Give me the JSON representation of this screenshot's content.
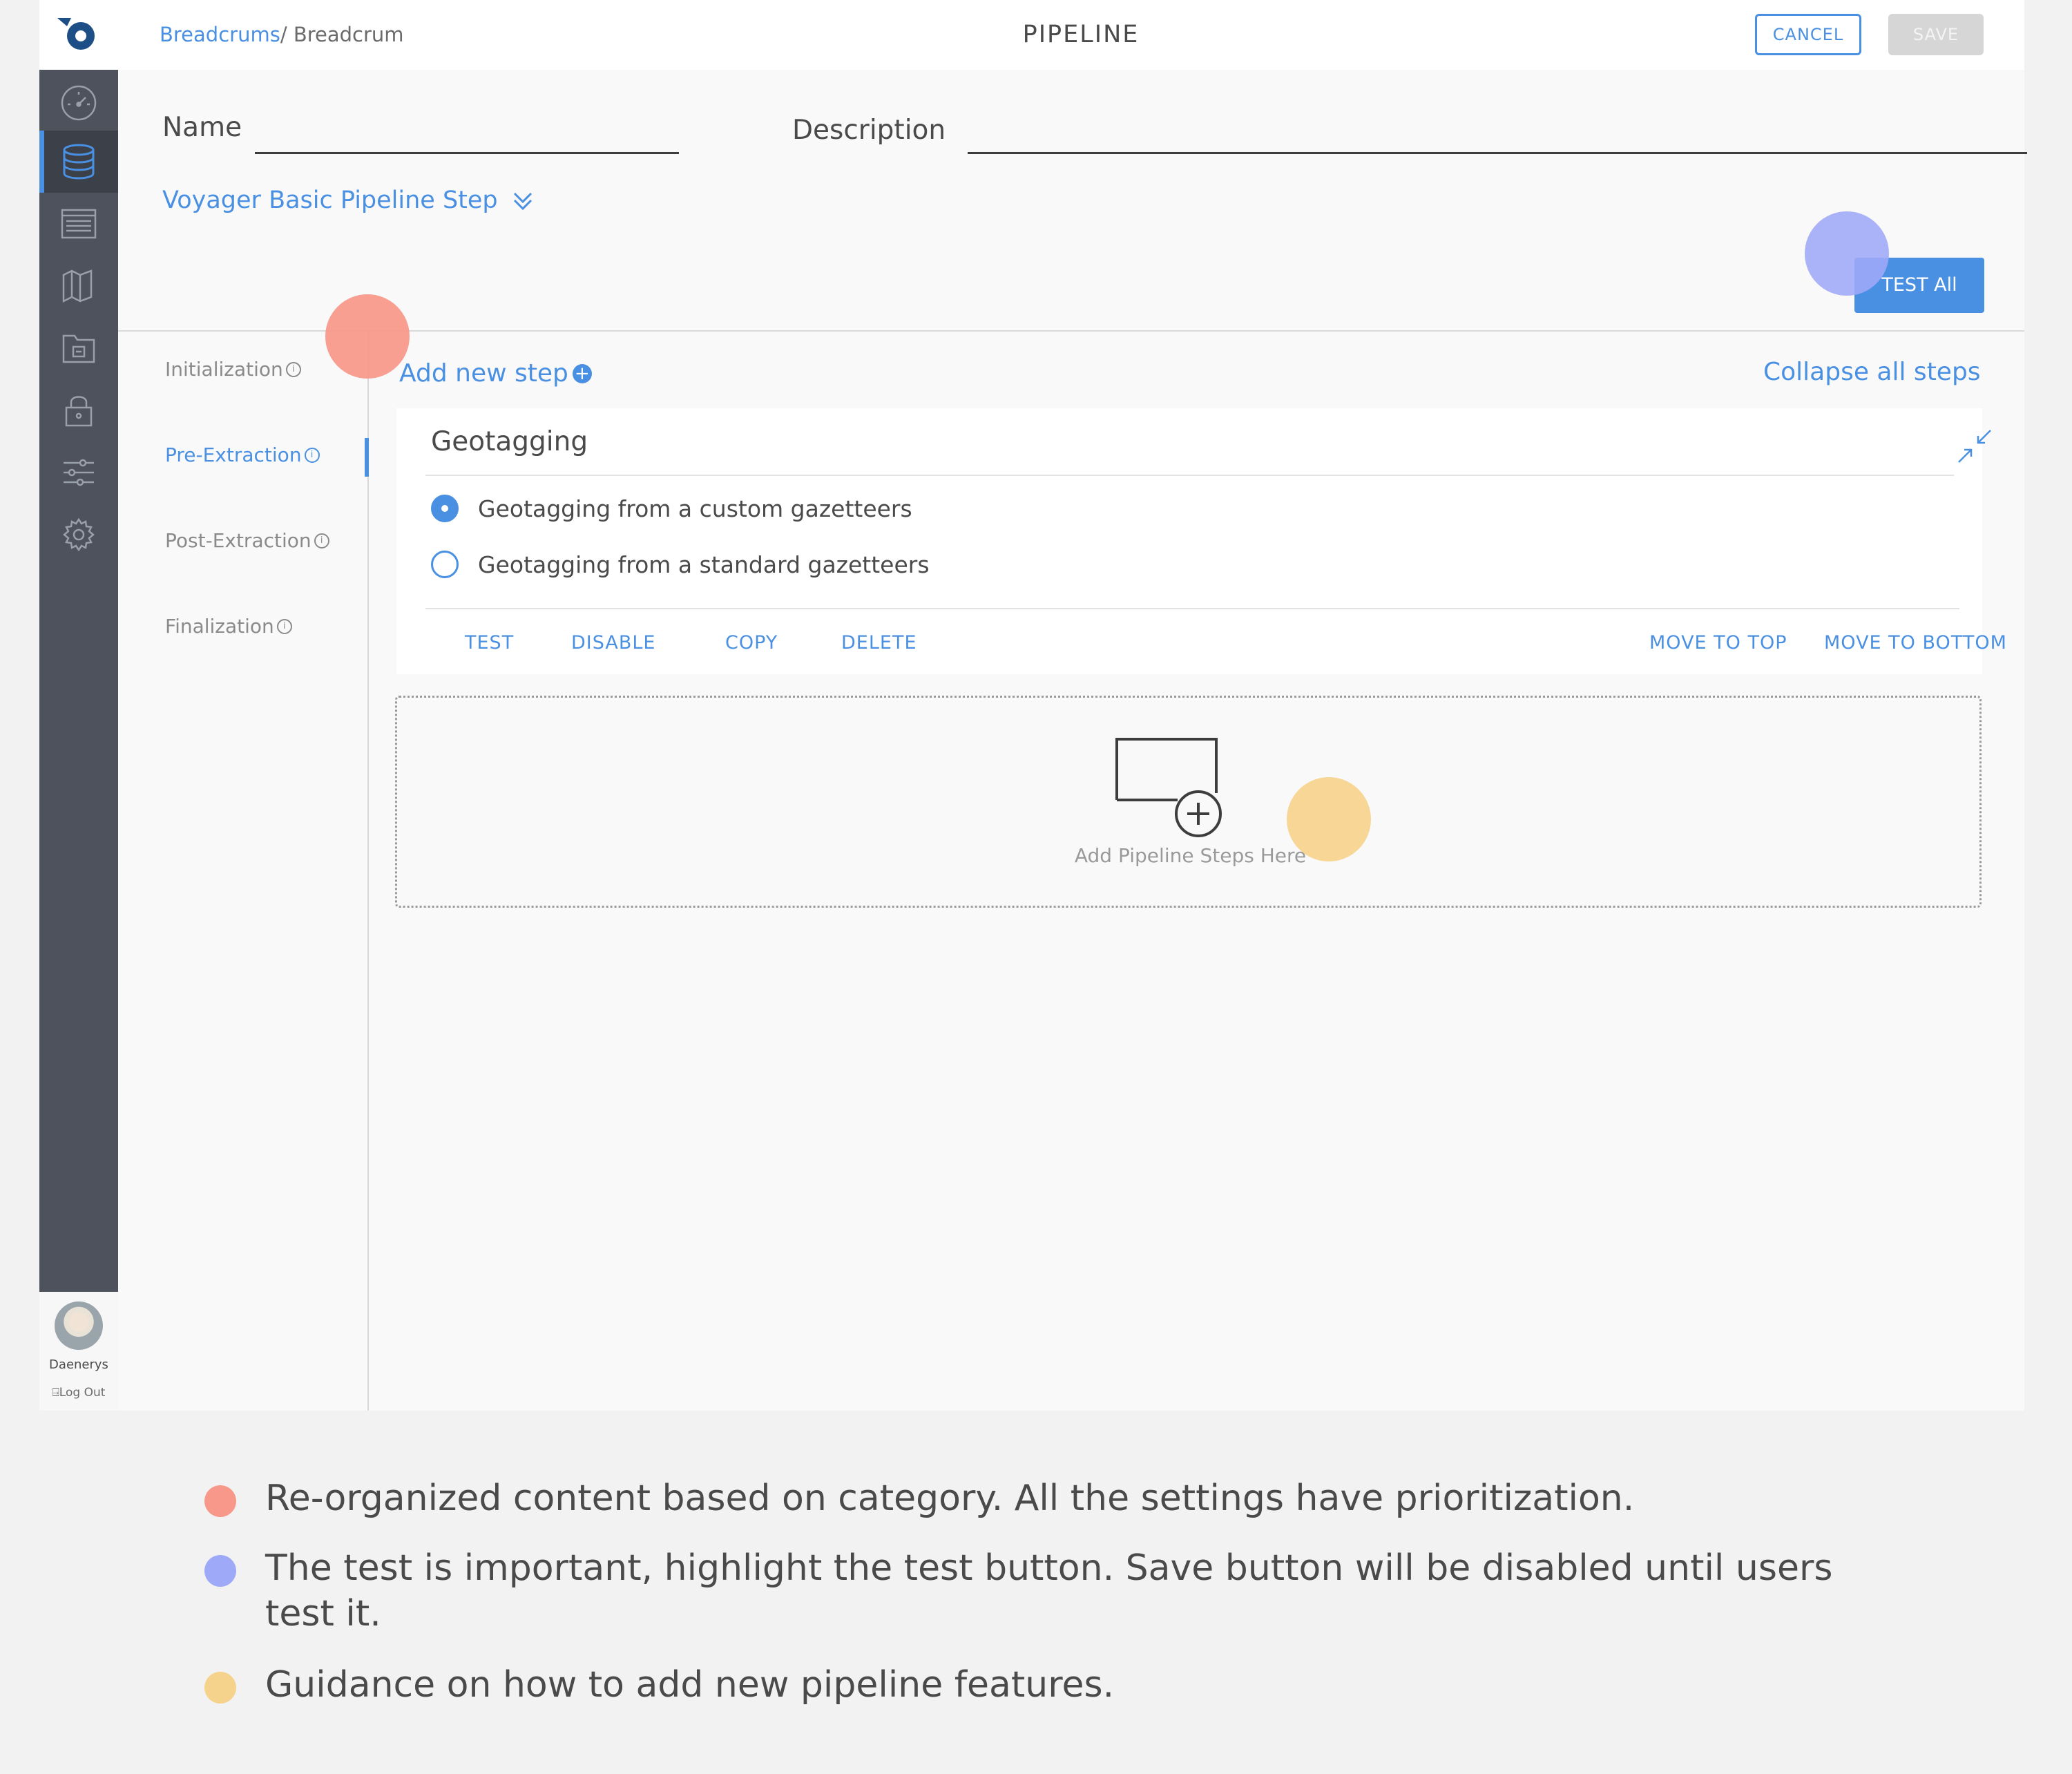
{
  "header": {
    "breadcrumb_link": "Breadcrums",
    "breadcrumb_sep": "/ ",
    "breadcrumb_current": "Breadcrum",
    "title": "PIPELINE",
    "cancel_label": "CANCEL",
    "save_label": "SAVE"
  },
  "sidebar": {
    "items": [
      {
        "icon": "dashboard-gauge-icon",
        "active": false
      },
      {
        "icon": "database-icon",
        "active": true
      },
      {
        "icon": "list-icon",
        "active": false
      },
      {
        "icon": "map-icon",
        "active": false
      },
      {
        "icon": "folder-icon",
        "active": false
      },
      {
        "icon": "lock-icon",
        "active": false
      },
      {
        "icon": "sliders-icon",
        "active": false
      },
      {
        "icon": "gear-icon",
        "active": false
      }
    ],
    "user_name": "Daenerys",
    "logout_label": "Log Out"
  },
  "form": {
    "name_label": "Name",
    "name_value": "",
    "description_label": "Description",
    "description_value": "",
    "step_type": "Voyager Basic Pipeline Step",
    "test_all_label": "TEST All"
  },
  "stages": [
    {
      "label": "Initialization",
      "active": false
    },
    {
      "label": "Pre-Extraction",
      "active": true
    },
    {
      "label": "Post-Extraction",
      "active": false
    },
    {
      "label": "Finalization",
      "active": false
    }
  ],
  "main": {
    "add_step_label": "Add new step",
    "collapse_all_label": "Collapse all steps",
    "step": {
      "title": "Geotagging",
      "options": [
        {
          "label": "Geotagging from a custom gazetteers",
          "checked": true
        },
        {
          "label": "Geotagging from a standard gazetteers",
          "checked": false
        }
      ],
      "actions": [
        "TEST",
        "DISABLE",
        "COPY",
        "DELETE",
        "MOVE TO TOP",
        "MOVE TO BOTTOM"
      ]
    },
    "dropzone_label": "Add Pipeline Steps Here"
  },
  "colors": {
    "accent": "#4a90e2",
    "sidebar": "#4d525c",
    "dot_red": "#f8988a",
    "dot_blue": "#9ea9f7",
    "dot_yellow": "#f6d38d"
  },
  "legend": [
    {
      "color": "#f8988a",
      "text": "Re-organized content based on category. All the settings have prioritization."
    },
    {
      "color": "#9ea9f7",
      "text": "The test is important, highlight the test button. Save button will be disabled until users test it."
    },
    {
      "color": "#f6d38d",
      "text": "Guidance on how to add new pipeline features."
    }
  ]
}
